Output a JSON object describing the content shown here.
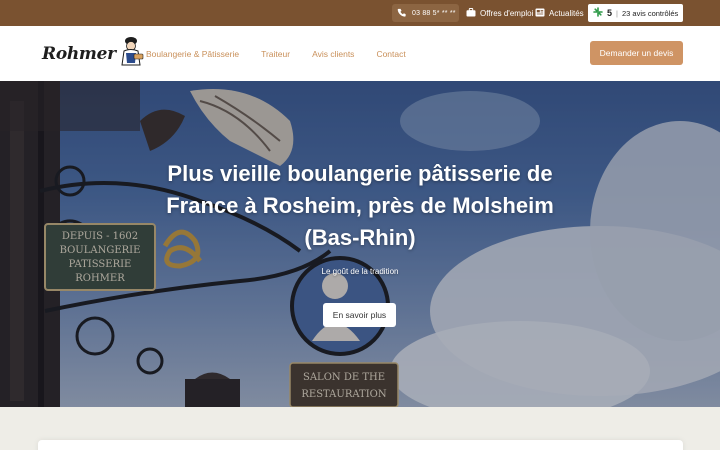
{
  "topbar": {
    "phone": "03 88 5* ** **",
    "jobs_label": "Offres d'emploi",
    "news_label": "Actualités",
    "rating_score": "5",
    "rating_label": "23 avis contrôlés"
  },
  "header": {
    "logo_text": "Rohmer",
    "nav": [
      "Boulangerie & Pâtisserie",
      "Traiteur",
      "Avis clients",
      "Contact"
    ],
    "cta_label": "Demander un devis"
  },
  "hero": {
    "title": "Plus vieille boulangerie pâtisserie de France à Rosheim, près de Molsheim (Bas-Rhin)",
    "subtitle": "Le goût de la tradition",
    "button_label": "En savoir plus",
    "sign_lines": [
      "DEPUIS - 1602",
      "BOULANGERIE",
      "PATISSERIE",
      "ROHMER"
    ],
    "lower_sign_lines": [
      "SALON DE THE",
      "RESTAURATION"
    ]
  },
  "colors": {
    "topbar": "#7a5230",
    "accent": "#cf9464",
    "nav_text": "#c9905a"
  }
}
